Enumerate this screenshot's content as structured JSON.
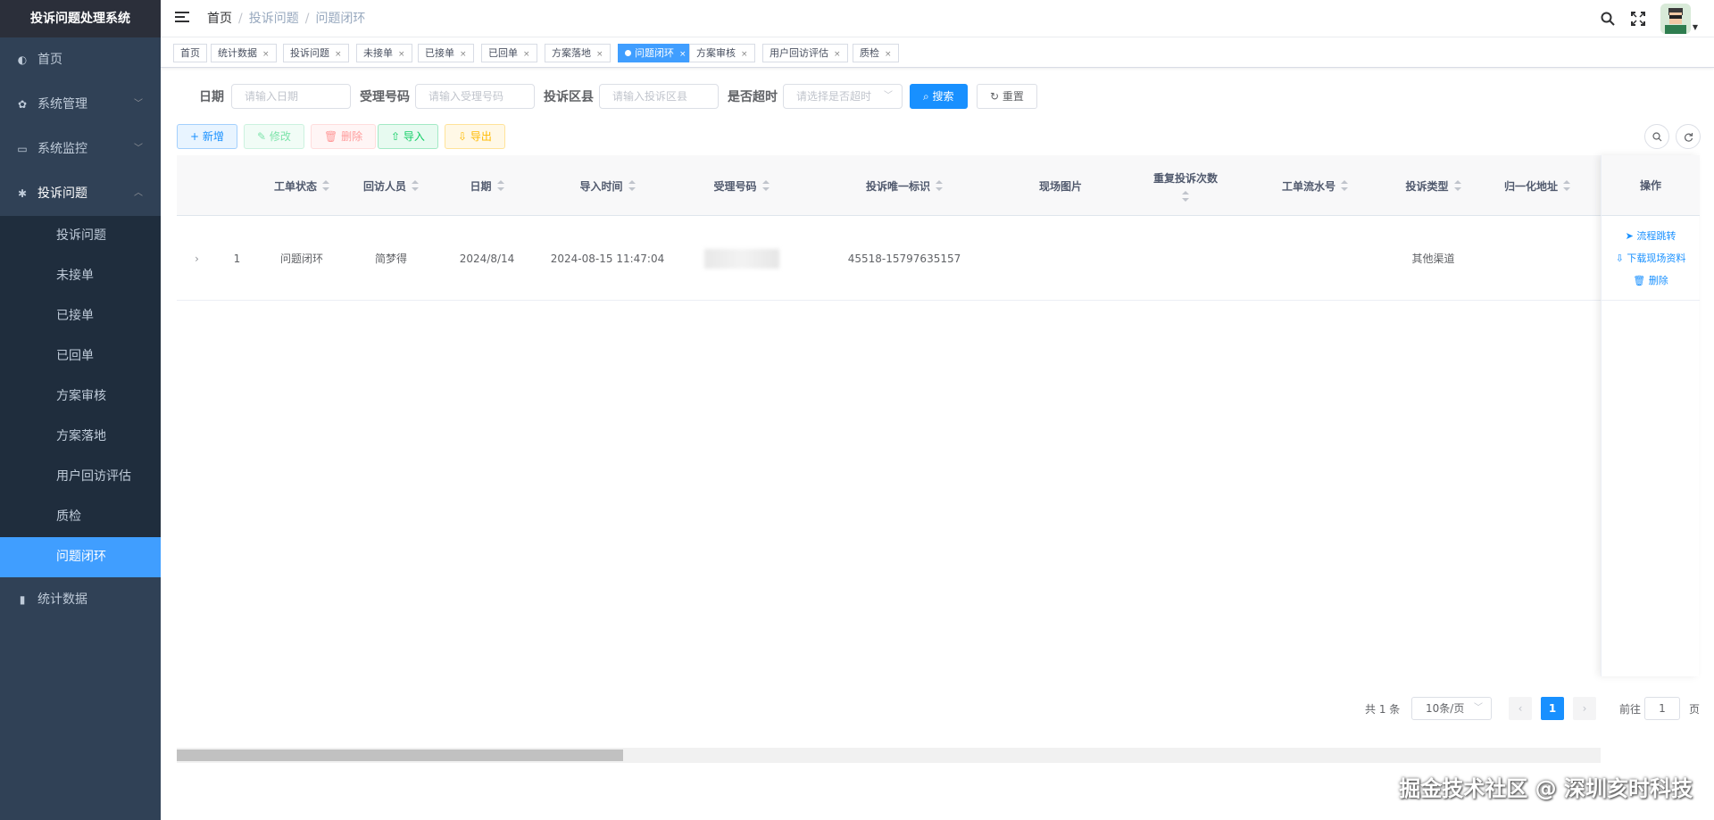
{
  "app": {
    "title": "投诉问题处理系统"
  },
  "sidebar": {
    "items": [
      {
        "label": "首页",
        "icon": "dashboard-icon"
      },
      {
        "label": "系统管理",
        "icon": "gear-icon"
      },
      {
        "label": "系统监控",
        "icon": "monitor-icon"
      },
      {
        "label": "投诉问题",
        "icon": "bug-icon"
      },
      {
        "label": "统计数据",
        "icon": "bar-chart-icon"
      }
    ],
    "submenu": [
      "投诉问题",
      "未接单",
      "已接单",
      "已回单",
      "方案审核",
      "方案落地",
      "用户回访评估",
      "质检",
      "问题闭环"
    ],
    "active": "问题闭环"
  },
  "breadcrumb": [
    "首页",
    "投诉问题",
    "问题闭环"
  ],
  "tags": [
    "首页",
    "统计数据",
    "投诉问题",
    "未接单",
    "已接单",
    "已回单",
    "方案落地",
    "问题闭环",
    "方案审核",
    "用户回访评估",
    "质检"
  ],
  "search": {
    "date_label": "日期",
    "date_placeholder": "请输入日期",
    "code_label": "受理号码",
    "code_placeholder": "请输入受理号码",
    "district_label": "投诉区县",
    "district_placeholder": "请输入投诉区县",
    "timeout_label": "是否超时",
    "timeout_placeholder": "请选择是否超时",
    "search_btn": "搜索",
    "reset_btn": "重置"
  },
  "toolbar": {
    "add": "新增",
    "edit": "修改",
    "delete": "删除",
    "import": "导入",
    "export": "导出"
  },
  "table": {
    "columns": [
      "工单状态",
      "回访人员",
      "日期",
      "导入时间",
      "受理号码",
      "投诉唯一标识",
      "现场图片",
      "重复投诉次数",
      "工单流水号",
      "投诉类型",
      "归一化地址",
      "操作"
    ],
    "rows": [
      {
        "index": "1",
        "status": "问题闭环",
        "visitor": "简梦得",
        "date": "2024/8/14",
        "import_time": "2024-08-15 11:47:04",
        "unique_id": "45518-15797635157",
        "type": "其他渠道"
      }
    ],
    "ops": [
      "流程跳转",
      "下载现场资料",
      "删除"
    ]
  },
  "pagination": {
    "total": "共 1 条",
    "page_size": "10条/页",
    "current": "1",
    "goto_label": "前往",
    "goto_value": "1",
    "goto_unit": "页"
  },
  "watermark": "掘金技术社区 @ 深圳亥时科技"
}
